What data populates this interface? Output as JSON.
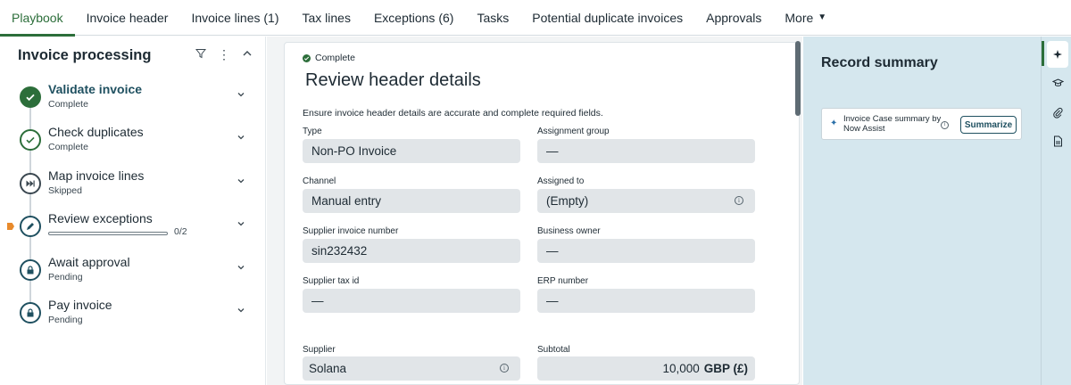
{
  "tabs": [
    {
      "label": "Playbook"
    },
    {
      "label": "Invoice header"
    },
    {
      "label": "Invoice lines (1)"
    },
    {
      "label": "Tax lines"
    },
    {
      "label": "Exceptions (6)"
    },
    {
      "label": "Tasks"
    },
    {
      "label": "Potential duplicate invoices"
    },
    {
      "label": "Approvals"
    },
    {
      "label": "More"
    }
  ],
  "playbook": {
    "title": "Invoice processing",
    "steps": [
      {
        "title": "Validate invoice",
        "status": "Complete",
        "icon": "check-filled-icon"
      },
      {
        "title": "Check duplicates",
        "status": "Complete",
        "icon": "check-outline-icon"
      },
      {
        "title": "Map invoice lines",
        "status": "Skipped",
        "icon": "skip-forward-icon"
      },
      {
        "title": "Review exceptions",
        "progress_label": "0/2",
        "progress": 0.0,
        "icon": "pencil-icon"
      },
      {
        "title": "Await approval",
        "status": "Pending",
        "icon": "lock-icon"
      },
      {
        "title": "Pay invoice",
        "status": "Pending",
        "icon": "lock-icon"
      }
    ]
  },
  "card": {
    "status": "Complete",
    "title": "Review header details",
    "description": "Ensure invoice header details are accurate and complete required fields.",
    "fields": {
      "type": {
        "label": "Type",
        "value": "Non-PO Invoice"
      },
      "assignment_group": {
        "label": "Assignment group",
        "value": "—"
      },
      "channel": {
        "label": "Channel",
        "value": "Manual entry"
      },
      "assigned_to": {
        "label": "Assigned to",
        "value": "(Empty)"
      },
      "supplier_invoice_number": {
        "label": "Supplier invoice number",
        "value": "sin232432"
      },
      "business_owner": {
        "label": "Business owner",
        "value": "—"
      },
      "supplier_tax_id": {
        "label": "Supplier tax id",
        "value": "—"
      },
      "erp_number": {
        "label": "ERP number",
        "value": "—"
      },
      "supplier": {
        "label": "Supplier",
        "value": "Solana"
      },
      "subtotal": {
        "label": "Subtotal",
        "value": "10,000",
        "currency": "GBP (£)"
      }
    }
  },
  "record_summary": {
    "title": "Record summary",
    "assist_text": "Invoice Case summary by Now Assist",
    "summarize_label": "Summarize"
  },
  "colors": {
    "accent_green": "#2c6e3a",
    "panel_blue": "#d5e7ee",
    "current_marker": "#e88a2c"
  }
}
